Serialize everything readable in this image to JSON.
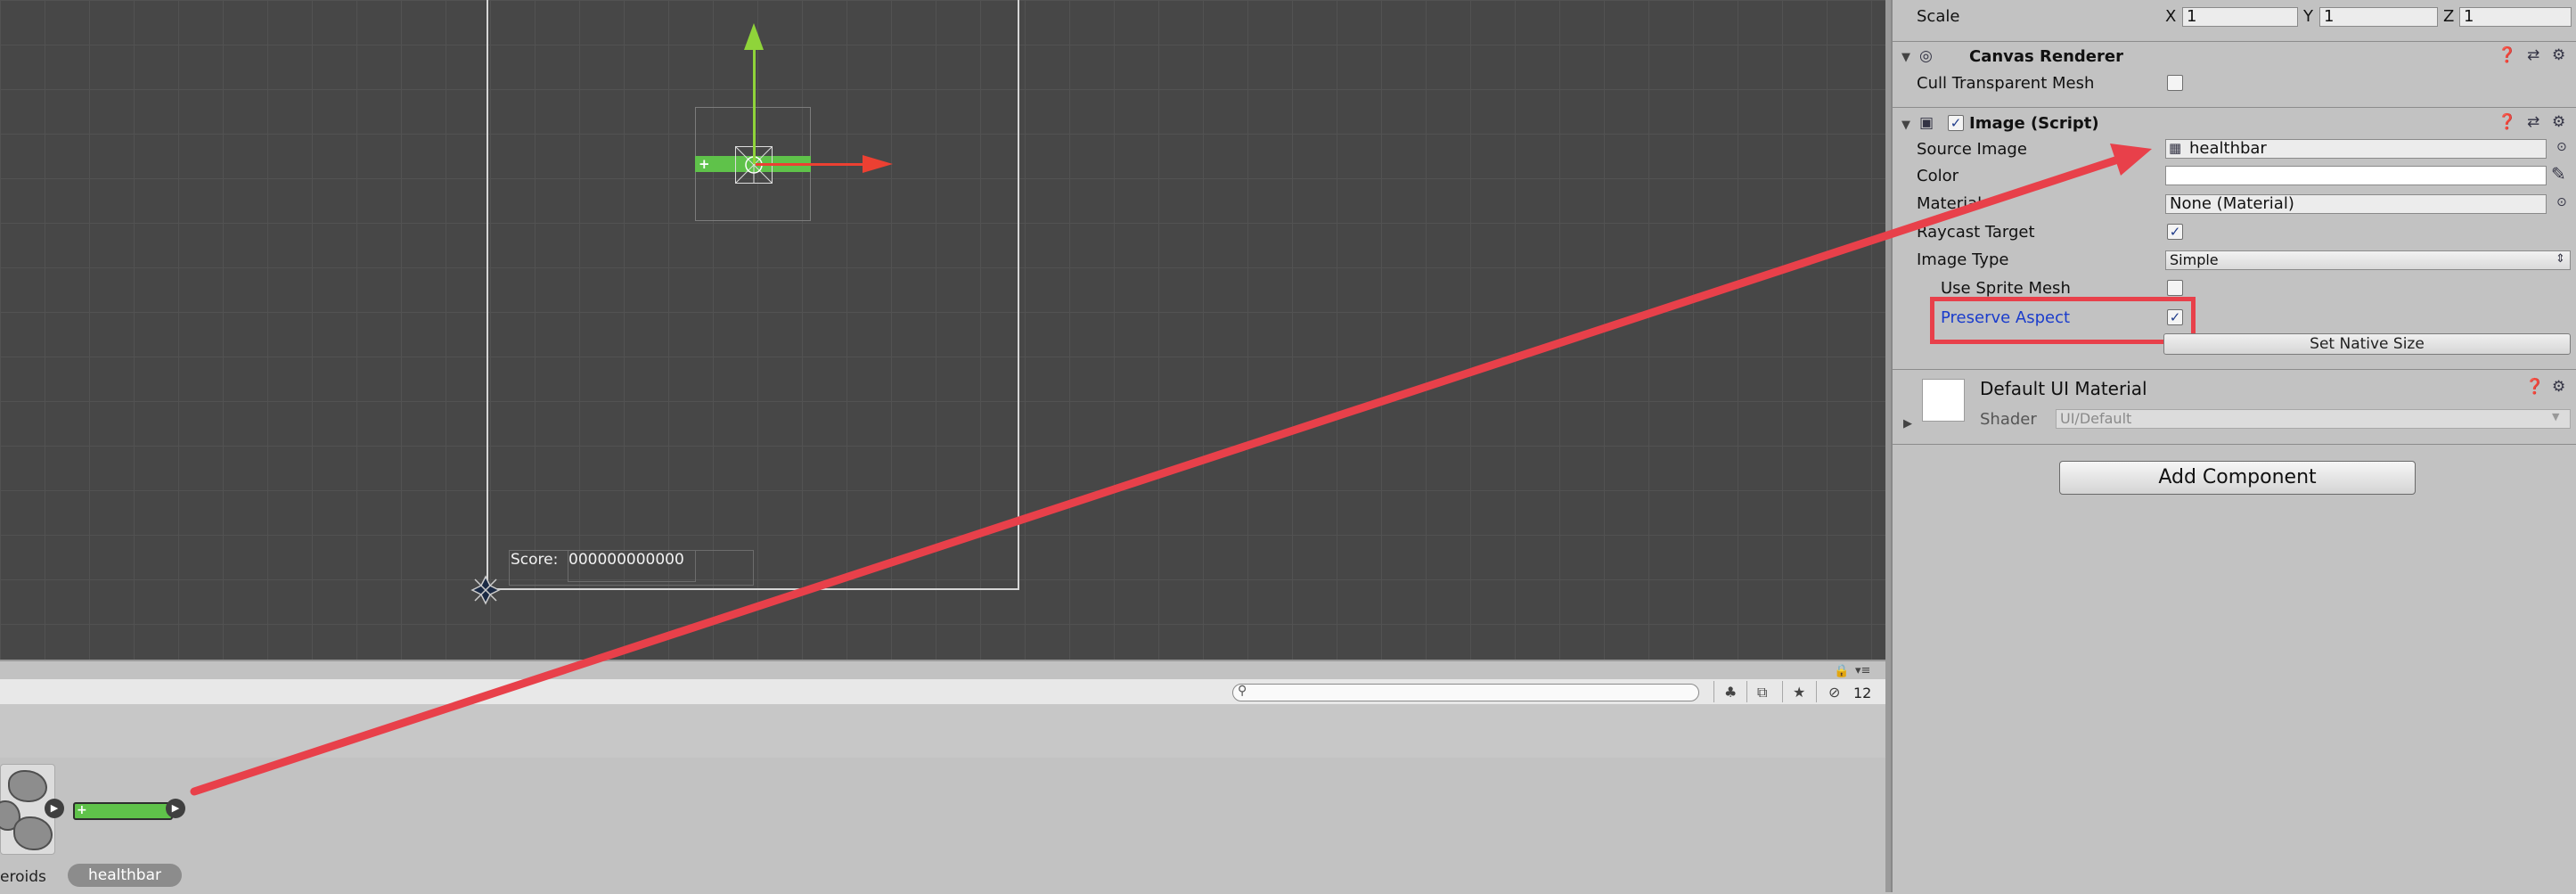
{
  "scene": {
    "score_label": "Score:",
    "score_value": "000000000000"
  },
  "project": {
    "hidden_count": "12",
    "assets": [
      {
        "label": "eroids",
        "icon": "asteroid-sprites-icon"
      },
      {
        "label": "healthbar",
        "icon": "healthbar-sprite-icon"
      }
    ]
  },
  "inspector": {
    "transform": {
      "scale_label": "Scale",
      "x_label": "X",
      "x_value": "1",
      "y_label": "Y",
      "y_value": "1",
      "z_label": "Z",
      "z_value": "1"
    },
    "canvas_renderer": {
      "title": "Canvas Renderer",
      "cull_label": "Cull Transparent Mesh",
      "cull_checked": false
    },
    "image": {
      "title": "Image (Script)",
      "enabled": true,
      "source_image_label": "Source Image",
      "source_image_value": "healthbar",
      "color_label": "Color",
      "color_value": "#ffffff",
      "material_label": "Material",
      "material_value": "None (Material)",
      "raycast_label": "Raycast Target",
      "raycast_checked": true,
      "image_type_label": "Image Type",
      "image_type_value": "Simple",
      "use_sprite_mesh_label": "Use Sprite Mesh",
      "use_sprite_mesh_checked": false,
      "preserve_aspect_label": "Preserve Aspect",
      "preserve_aspect_checked": true,
      "set_native_size_label": "Set Native Size"
    },
    "material": {
      "title": "Default UI Material",
      "shader_label": "Shader",
      "shader_value": "UI/Default"
    },
    "add_component_label": "Add Component"
  },
  "colors": {
    "highlight": "#e8404a",
    "healthbar_green": "#5fc24a",
    "gizmo_y": "#8fd43a",
    "gizmo_x": "#ec4032",
    "preserve_aspect_text": "#1a3ccc"
  }
}
